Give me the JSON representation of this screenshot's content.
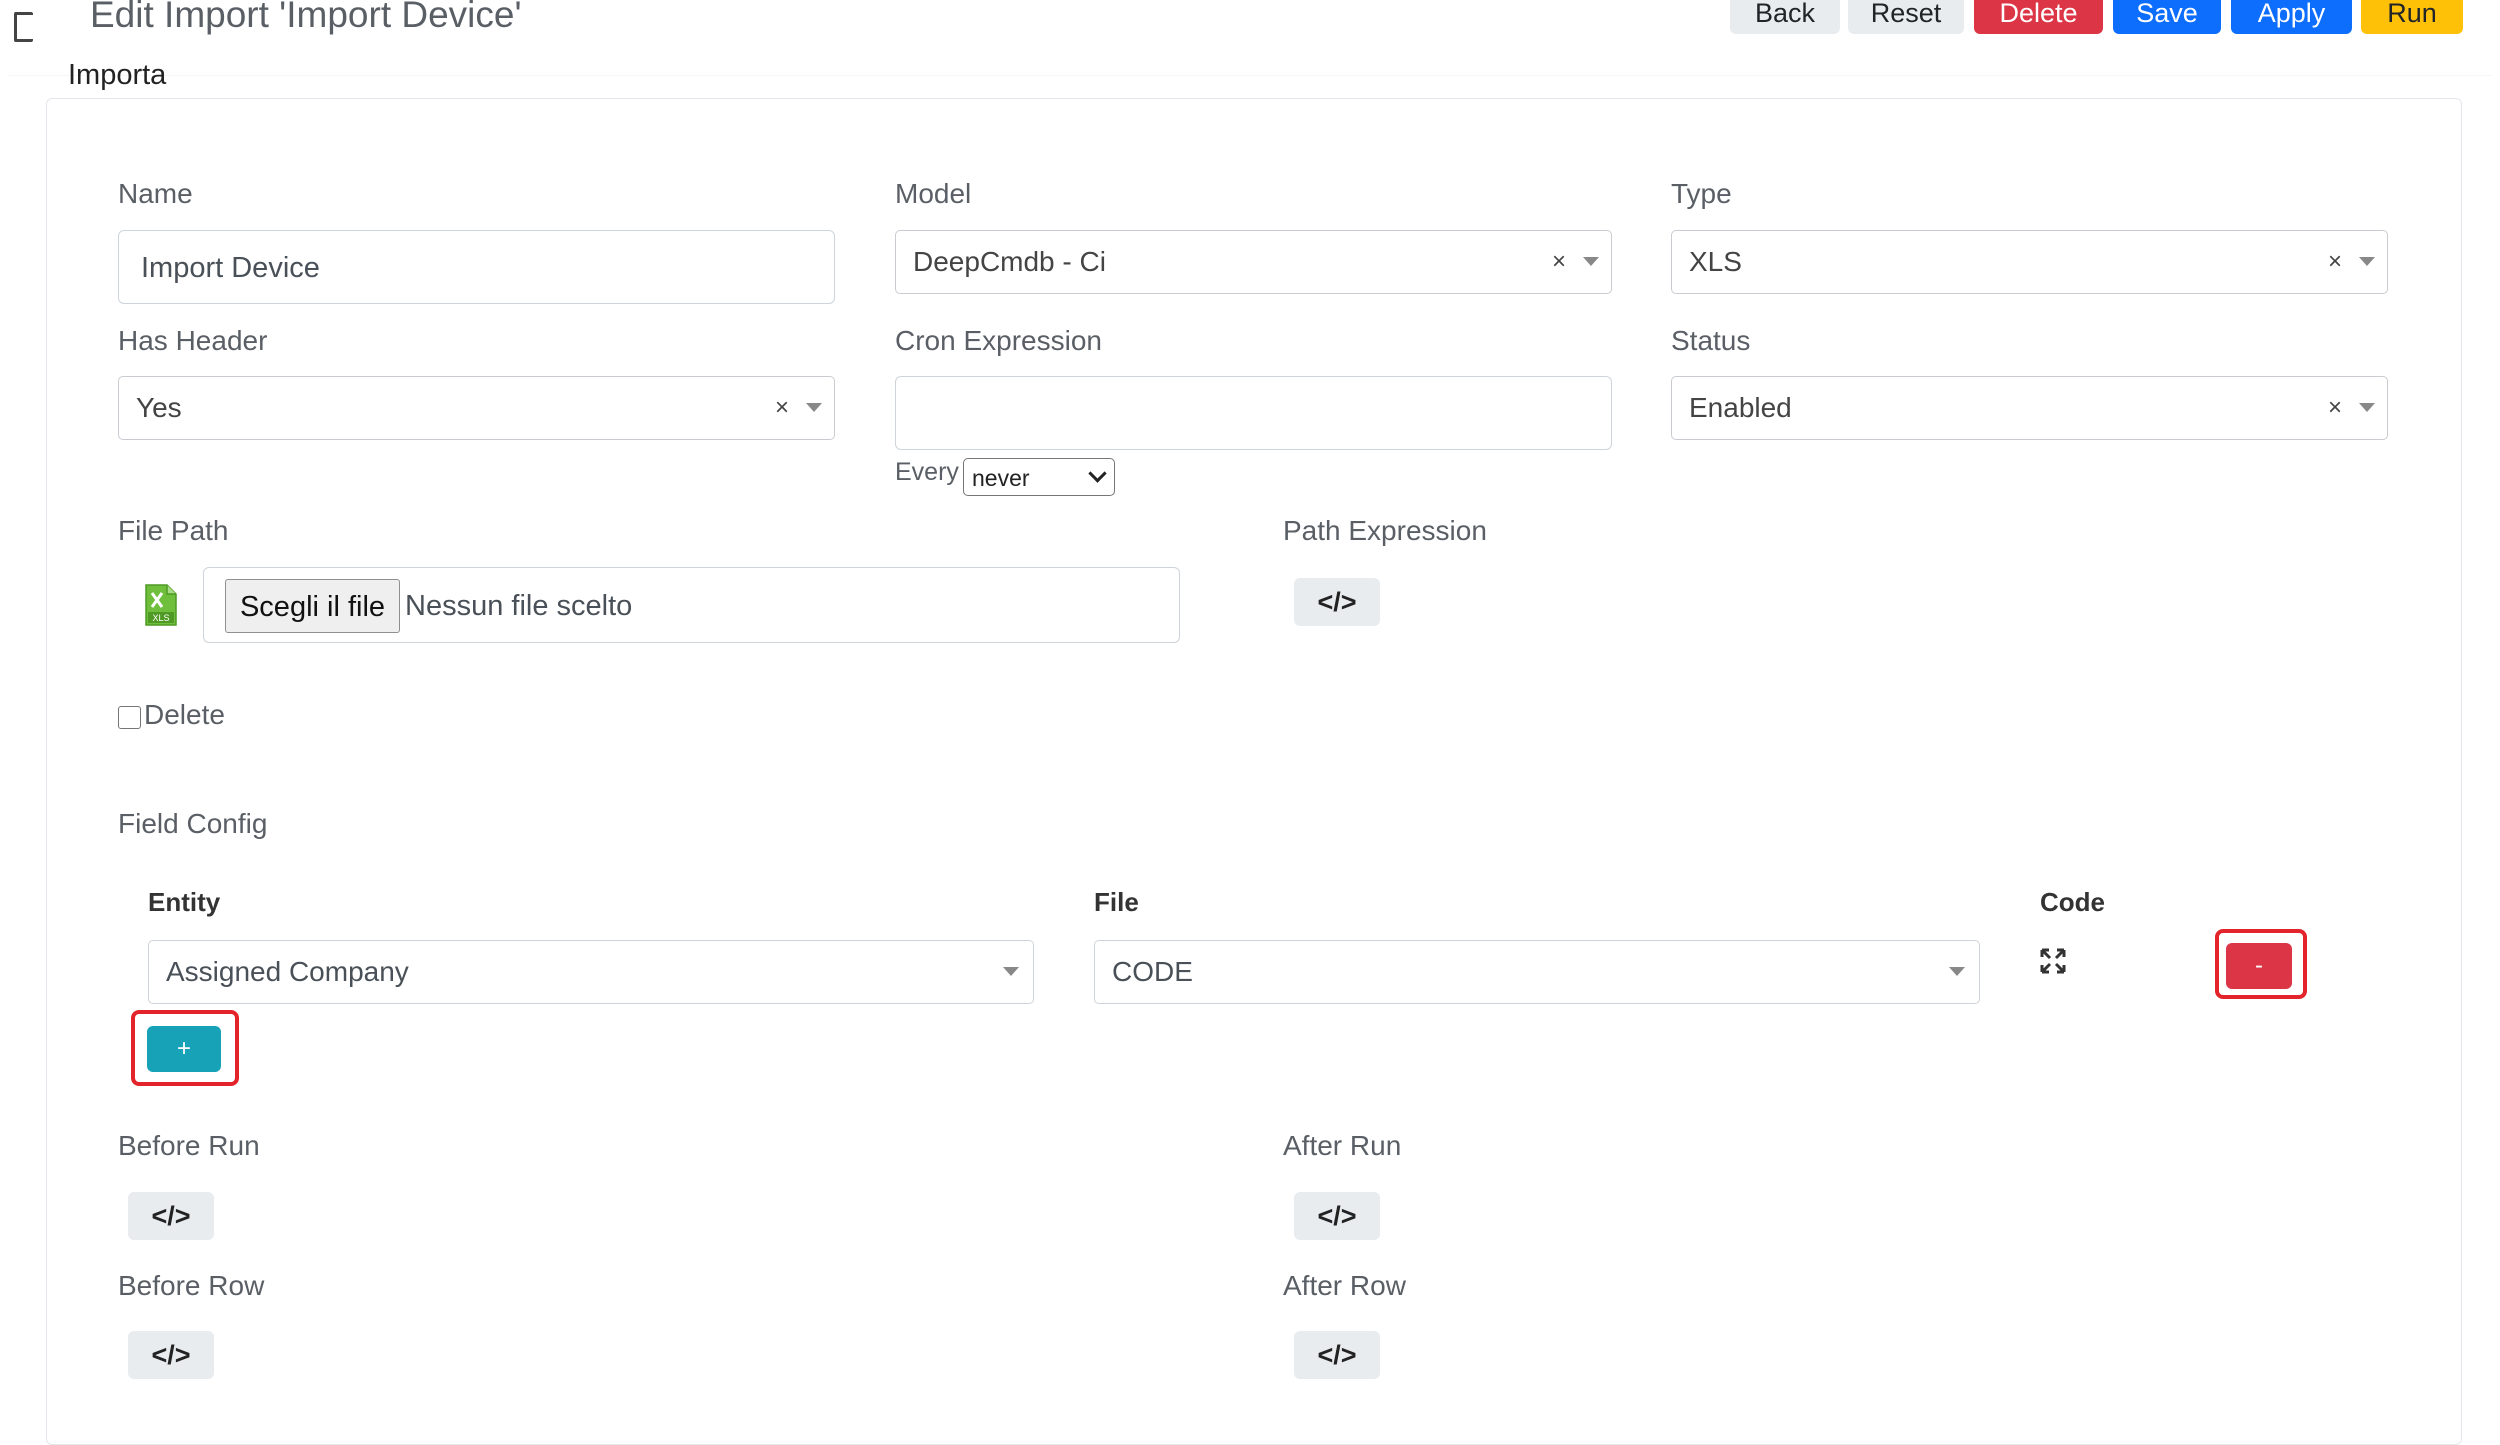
{
  "header": {
    "title": "Edit Import 'Import Device'",
    "buttons": {
      "back": "Back",
      "reset": "Reset",
      "delete": "Delete",
      "save": "Save",
      "apply": "Apply",
      "run": "Run"
    },
    "colors": {
      "danger": "#dc3545",
      "primary": "#0d6efd",
      "warning": "#ffc107",
      "secondary": "#e9ecef",
      "info": "#17a2b8"
    }
  },
  "section": {
    "title": "Importa"
  },
  "form": {
    "name": {
      "label": "Name",
      "value": "Import Device"
    },
    "model": {
      "label": "Model",
      "value": "DeepCmdb - Ci",
      "clear": "×"
    },
    "type": {
      "label": "Type",
      "value": "XLS",
      "clear": "×"
    },
    "has_header": {
      "label": "Has Header",
      "value": "Yes",
      "clear": "×"
    },
    "cron": {
      "label": "Cron Expression",
      "value": "",
      "every_label": "Every",
      "every_value": "never"
    },
    "status": {
      "label": "Status",
      "value": "Enabled",
      "clear": "×"
    },
    "file_path": {
      "label": "File Path",
      "choose_button": "Scegli il file",
      "no_file": "Nessun file scelto",
      "icon": "xls-file-icon"
    },
    "path_expression": {
      "label": "Path Expression",
      "code_button": "</>"
    },
    "delete_checkbox": {
      "label": "Delete",
      "checked": false
    },
    "field_config": {
      "label": "Field Config",
      "columns": {
        "entity": "Entity",
        "file": "File",
        "code": "Code"
      },
      "rows": [
        {
          "entity": "Assigned Company",
          "file": "CODE",
          "code_icon": "expand-icon",
          "remove_label": "-"
        }
      ],
      "add_label": "+"
    },
    "before_run": {
      "label": "Before Run",
      "code_button": "</>"
    },
    "after_run": {
      "label": "After Run",
      "code_button": "</>"
    },
    "before_row": {
      "label": "Before Row",
      "code_button": "</>"
    },
    "after_row": {
      "label": "After Row",
      "code_button": "</>"
    }
  }
}
